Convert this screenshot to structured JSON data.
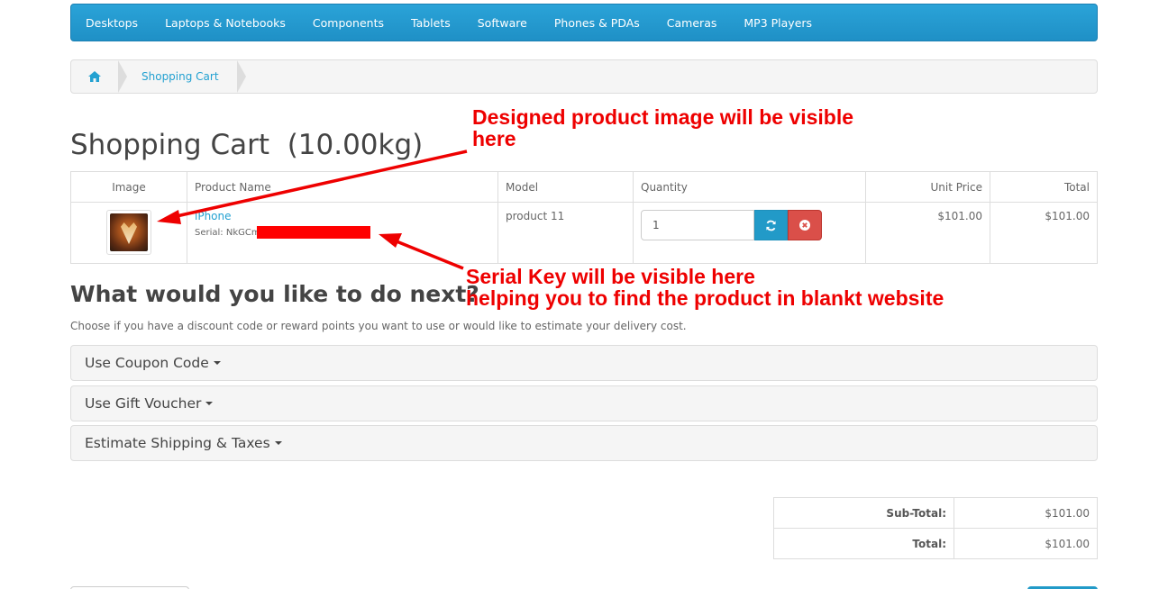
{
  "menu": [
    "Desktops",
    "Laptops & Notebooks",
    "Components",
    "Tablets",
    "Software",
    "Phones & PDAs",
    "Cameras",
    "MP3 Players"
  ],
  "breadcrumb": {
    "current": "Shopping Cart"
  },
  "page_title": "Shopping Cart  (10.00kg)",
  "cart": {
    "headers": {
      "image": "Image",
      "name": "Product Name",
      "model": "Model",
      "quantity": "Quantity",
      "unit_price": "Unit Price",
      "total": "Total"
    },
    "row": {
      "name": "iPhone",
      "serial": "Serial: NkGCm",
      "model": "product 11",
      "quantity": "1",
      "unit_price": "$101.00",
      "total": "$101.00"
    }
  },
  "next": {
    "title": "What would you like to do next?",
    "desc": "Choose if you have a discount code or reward points you want to use or would like to estimate your delivery cost.",
    "panels": [
      "Use Coupon Code",
      "Use Gift Voucher",
      "Estimate Shipping & Taxes"
    ]
  },
  "totals": [
    {
      "label": "Sub-Total:",
      "value": "$101.00"
    },
    {
      "label": "Total:",
      "value": "$101.00"
    }
  ],
  "annotations": {
    "image": [
      "Designed product image will be visible",
      "here"
    ],
    "serial": [
      "Serial Key will be visible here",
      "helping you to find the product in blankt website"
    ]
  },
  "colors": {
    "menu": "#229ac8",
    "link": "#23a1d1",
    "annotation": "#ee0000",
    "remove": "#da4f49"
  }
}
